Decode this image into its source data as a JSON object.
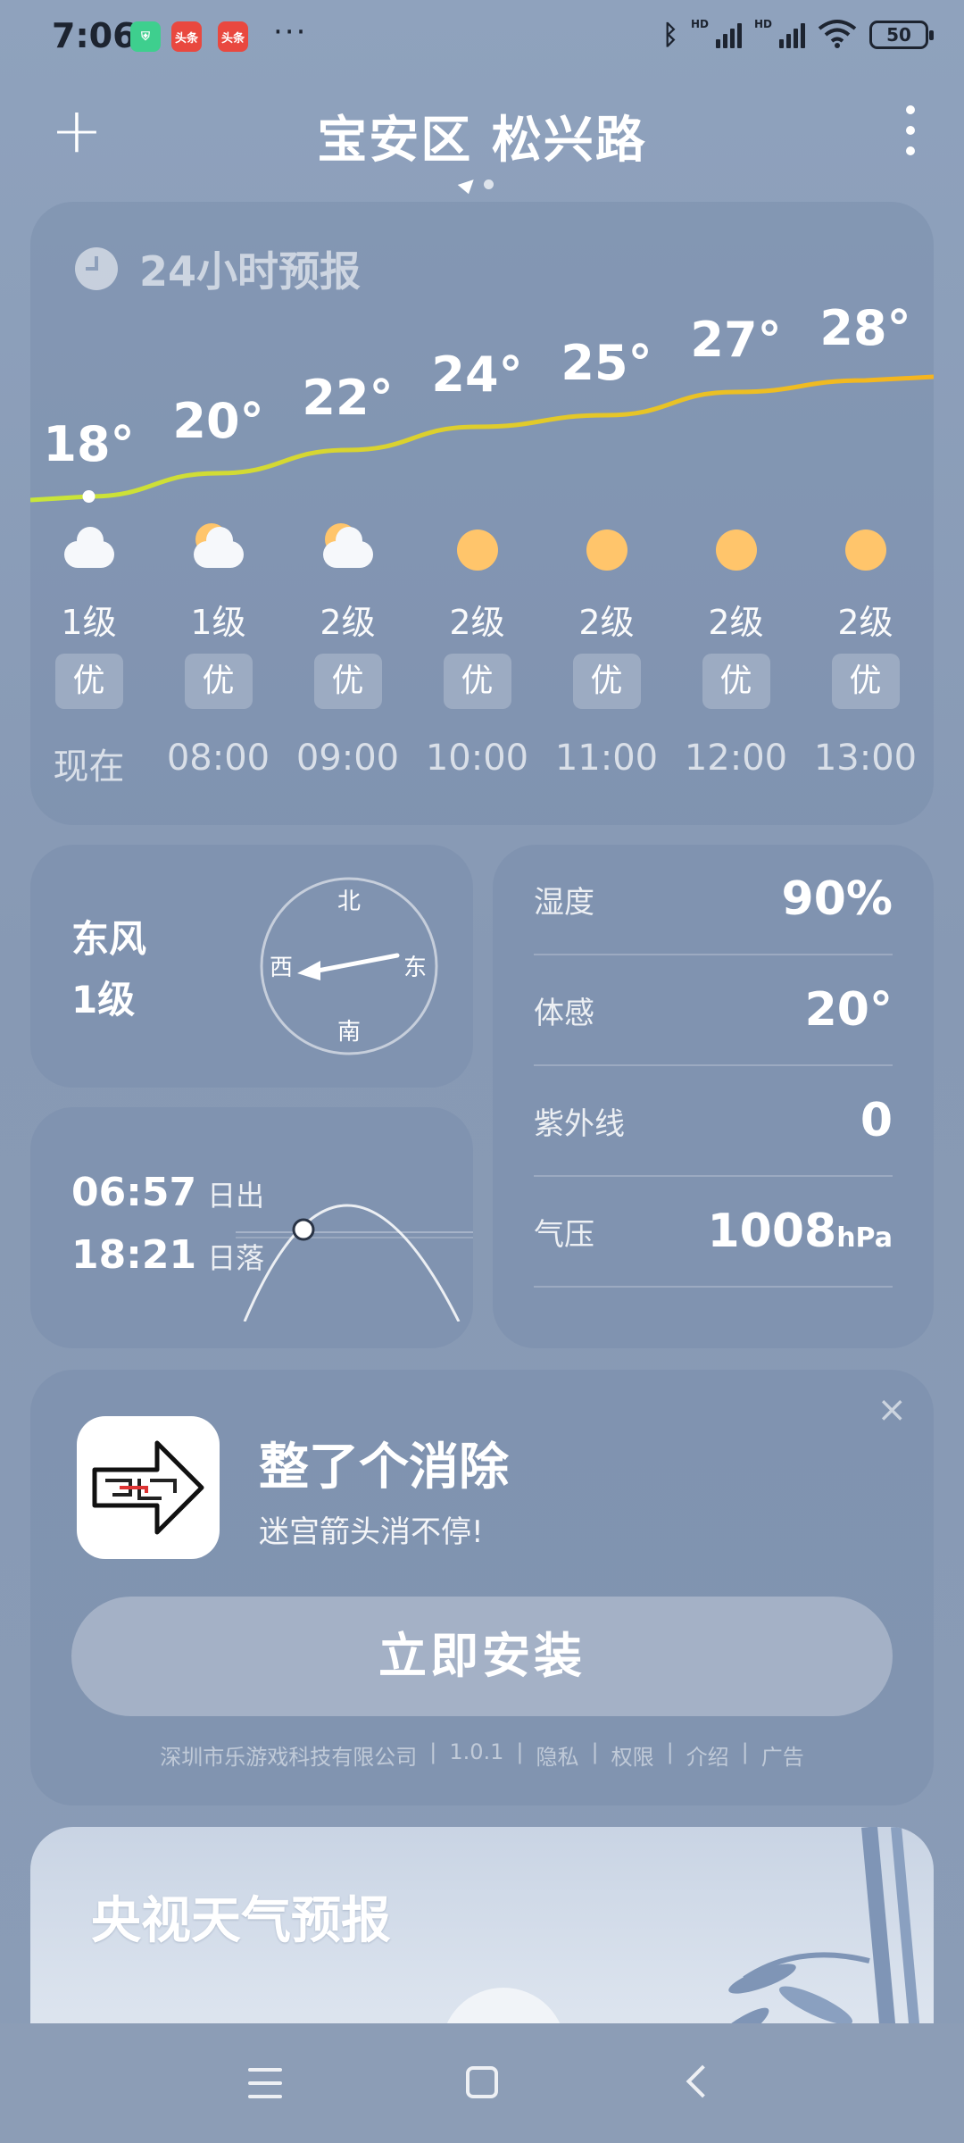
{
  "status_bar": {
    "time": "7:06",
    "battery": "50",
    "hd1": "HD",
    "hd2": "HD",
    "app_news_1": "头条",
    "app_news_2": "头条",
    "dots": "···"
  },
  "header": {
    "add_label": "+",
    "location": "宝安区 松兴路"
  },
  "forecast": {
    "title": "24小时预报",
    "hours": [
      {
        "temp": "18°",
        "icon": "cloudy-icon",
        "wind": "1级",
        "aqi": "优",
        "time": "现在"
      },
      {
        "temp": "20°",
        "icon": "partly-cloudy-icon",
        "wind": "1级",
        "aqi": "优",
        "time": "08:00"
      },
      {
        "temp": "22°",
        "icon": "partly-cloudy-icon",
        "wind": "2级",
        "aqi": "优",
        "time": "09:00"
      },
      {
        "temp": "24°",
        "icon": "sun-icon",
        "wind": "2级",
        "aqi": "优",
        "time": "10:00"
      },
      {
        "temp": "25°",
        "icon": "sun-icon",
        "wind": "2级",
        "aqi": "优",
        "time": "11:00"
      },
      {
        "temp": "27°",
        "icon": "sun-icon",
        "wind": "2级",
        "aqi": "优",
        "time": "12:00"
      },
      {
        "temp": "28°",
        "icon": "sun-icon",
        "wind": "2级",
        "aqi": "优",
        "time": "13:00"
      }
    ],
    "temps_numeric": [
      18,
      20,
      22,
      24,
      25,
      27,
      28
    ]
  },
  "wind": {
    "direction": "东风",
    "level": "1级",
    "compass": {
      "north": "北",
      "south": "南",
      "east": "东",
      "west": "西"
    }
  },
  "sun": {
    "sunrise": "06:57",
    "sunrise_label": "日出",
    "sunset": "18:21",
    "sunset_label": "日落"
  },
  "details": [
    {
      "label": "湿度",
      "value": "90%",
      "unit": ""
    },
    {
      "label": "体感",
      "value": "20°",
      "unit": ""
    },
    {
      "label": "紫外线",
      "value": "0",
      "unit": ""
    },
    {
      "label": "气压",
      "value": "1008",
      "unit": "hPa"
    }
  ],
  "ad": {
    "title": "整了个消除",
    "subtitle": "迷宫箭头消不停!",
    "install_label": "立即安装",
    "close": "×",
    "footer": [
      "深圳市乐游戏科技有限公司",
      "|",
      "1.0.1",
      "|",
      "隐私",
      "|",
      "权限",
      "|",
      "介绍",
      "|",
      "广告"
    ]
  },
  "cctv": {
    "title": "央视天气预报"
  },
  "colors": {
    "curve_start": "#c8e63a",
    "curve_end": "#f6b41e",
    "sun": "#ffc56b"
  }
}
